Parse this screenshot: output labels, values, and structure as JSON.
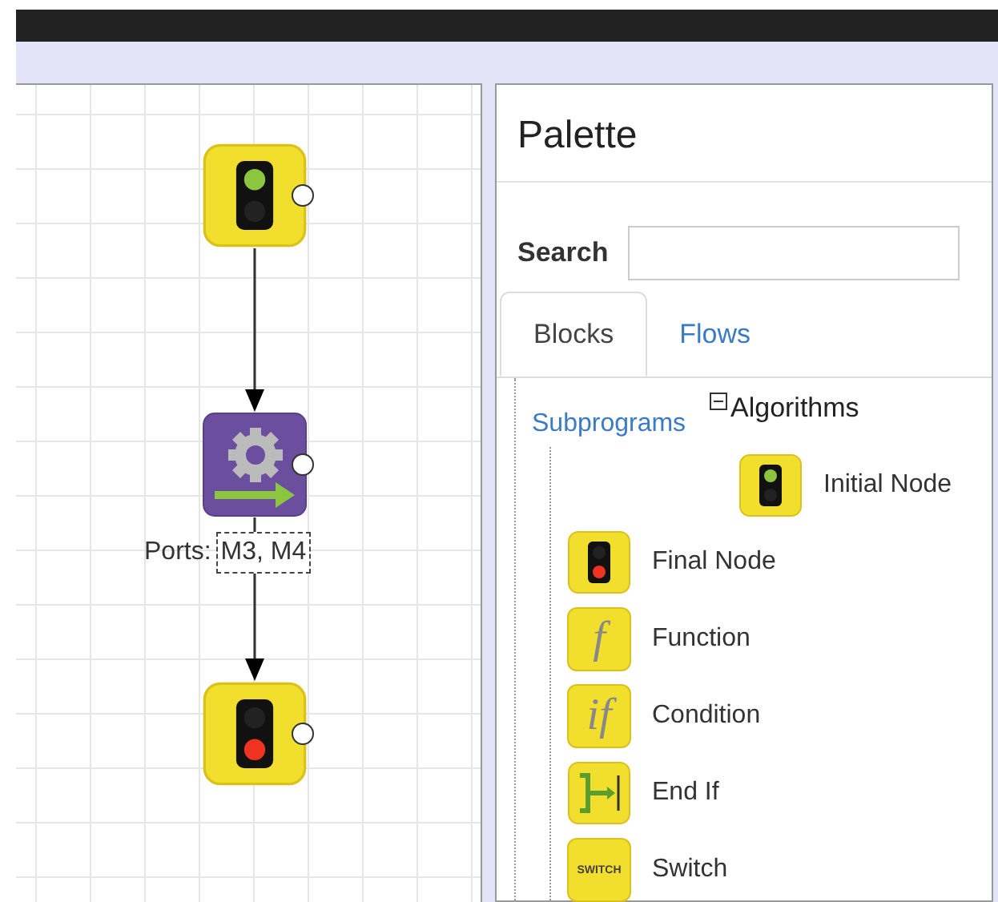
{
  "canvas": {
    "nodes": [
      {
        "kind": "initial"
      },
      {
        "kind": "action",
        "ports_label": "Ports:",
        "ports_value": "M3, M4"
      },
      {
        "kind": "final"
      }
    ]
  },
  "palette": {
    "title": "Palette",
    "search": {
      "label": "Search"
    },
    "tabs": [
      {
        "label": "Blocks",
        "selected": true
      },
      {
        "label": "Flows",
        "selected": false
      }
    ],
    "tree": {
      "root": "Subprograms",
      "group": {
        "label": "Algorithms",
        "expanded": true,
        "children": [
          {
            "label": "Initial Node",
            "kind": "initial"
          },
          {
            "label": "Final Node",
            "kind": "final"
          },
          {
            "label": "Function",
            "kind": "glyph",
            "glyph": "f"
          },
          {
            "label": "Condition",
            "kind": "glyph",
            "glyph": "if"
          },
          {
            "label": "End If",
            "kind": "endif"
          },
          {
            "label": "Switch",
            "kind": "badge",
            "glyph": "SWITCH"
          }
        ]
      }
    }
  }
}
